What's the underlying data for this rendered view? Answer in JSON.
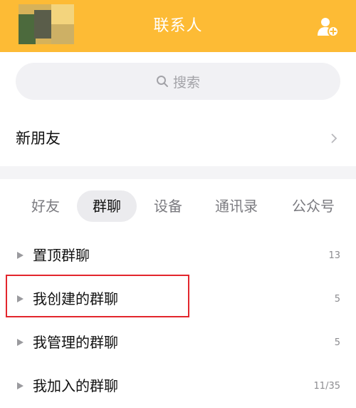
{
  "header": {
    "title": "联系人",
    "add_contact_icon": "add-contact-icon",
    "background": "#fdbb35"
  },
  "search": {
    "placeholder": "搜索",
    "icon": "search-icon"
  },
  "new_friends": {
    "label": "新朋友",
    "icon": "chevron-right-icon"
  },
  "tabs": [
    {
      "label": "好友",
      "active": false
    },
    {
      "label": "群聊",
      "active": true
    },
    {
      "label": "设备",
      "active": false
    },
    {
      "label": "通讯录",
      "active": false
    },
    {
      "label": "公众号",
      "active": false
    }
  ],
  "groups": [
    {
      "label": "置顶群聊",
      "count": "13"
    },
    {
      "label": "我创建的群聊",
      "count": "5",
      "highlighted": true
    },
    {
      "label": "我管理的群聊",
      "count": "5"
    },
    {
      "label": "我加入的群聊",
      "count": "11/35"
    }
  ],
  "colors": {
    "accent": "#fdbb35",
    "highlight_border": "#e3262d"
  }
}
